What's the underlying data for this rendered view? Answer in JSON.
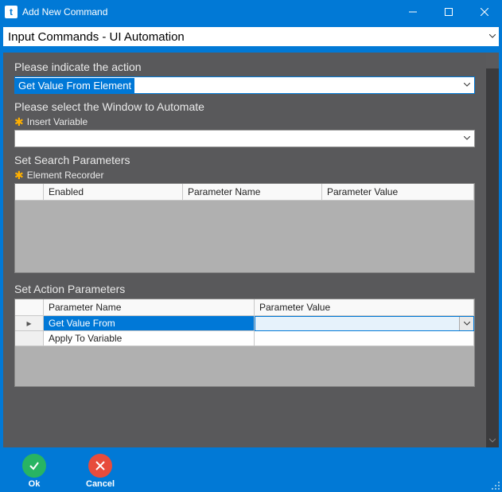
{
  "window": {
    "title": "Add New Command"
  },
  "category": {
    "value": "Input Commands - UI Automation"
  },
  "sections": {
    "action": {
      "label": "Please indicate the action",
      "value": "Get Value From Element"
    },
    "window": {
      "label": "Please select the Window to Automate",
      "helper": "Insert Variable",
      "value": ""
    },
    "search": {
      "label": "Set Search Parameters",
      "helper": "Element Recorder",
      "columns": {
        "enabled": "Enabled",
        "pname": "Parameter Name",
        "pvalue": "Parameter Value"
      }
    },
    "actionParams": {
      "label": "Set Action Parameters",
      "columns": {
        "pname": "Parameter Name",
        "pvalue": "Parameter Value"
      },
      "rows": [
        {
          "pname": "Get Value From",
          "pvalue": ""
        },
        {
          "pname": "Apply To Variable",
          "pvalue": ""
        }
      ]
    }
  },
  "footer": {
    "ok": "Ok",
    "cancel": "Cancel"
  }
}
